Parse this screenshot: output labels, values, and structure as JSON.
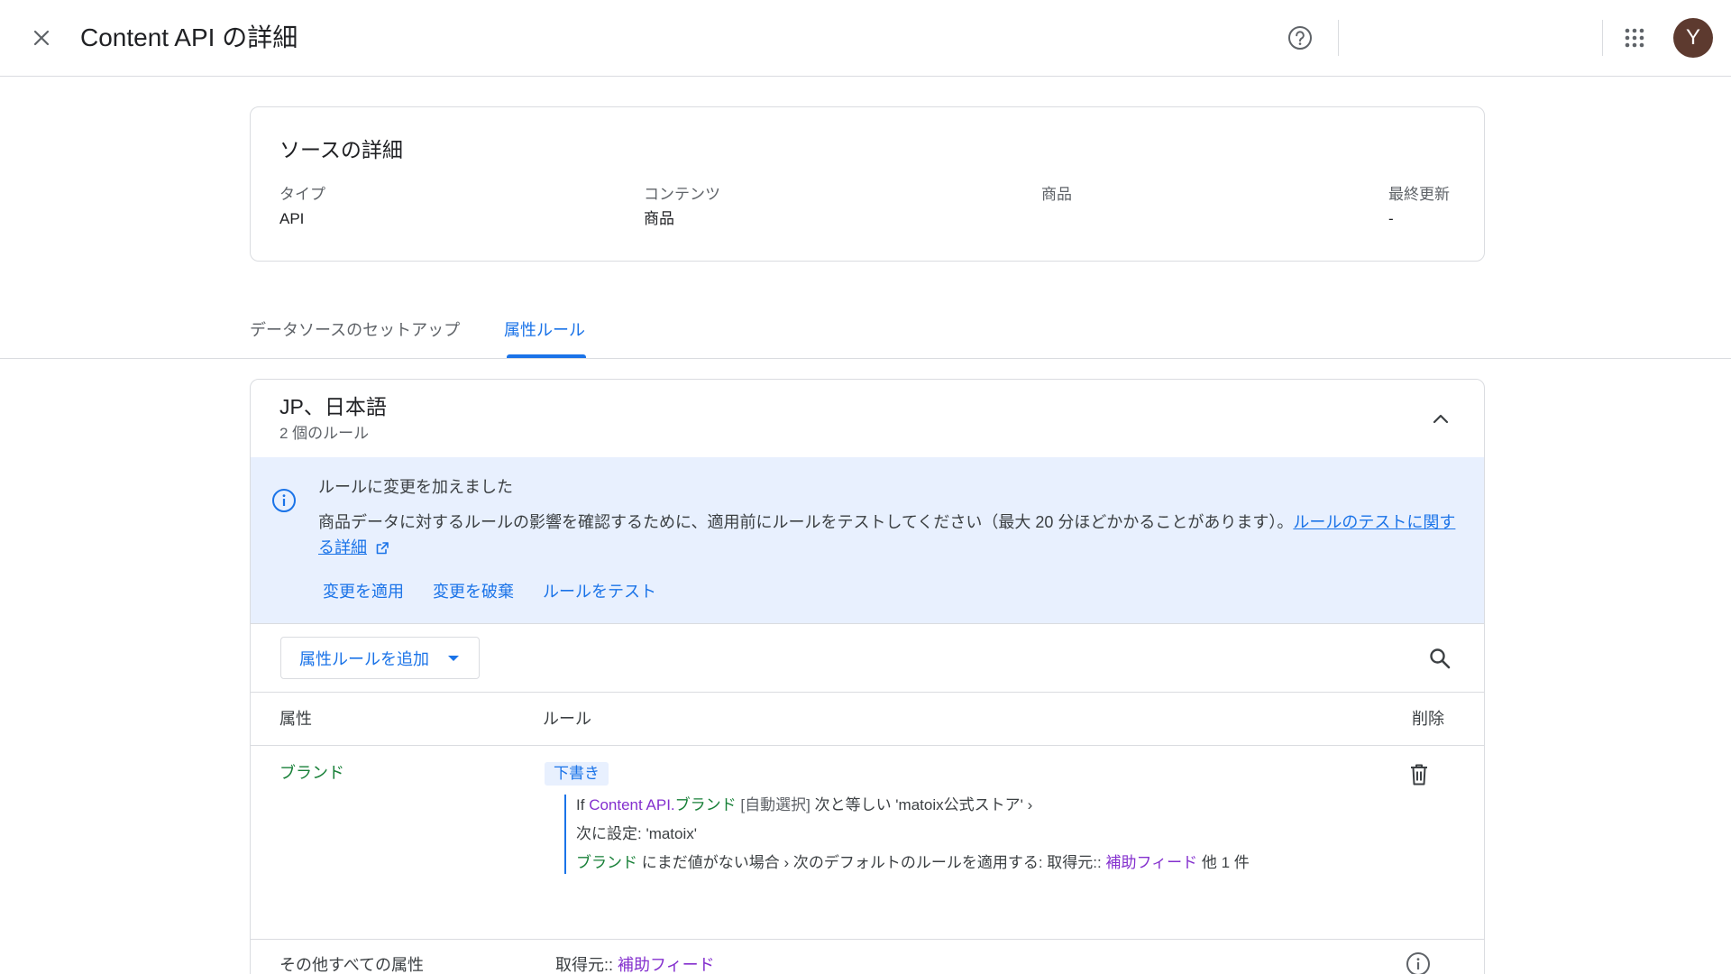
{
  "appbar": {
    "title": "Content API の詳細",
    "avatar_letter": "Y"
  },
  "source_details": {
    "heading": "ソースの詳細",
    "fields": [
      {
        "label": "タイプ",
        "value": "API"
      },
      {
        "label": "コンテンツ",
        "value": "商品"
      },
      {
        "label": "商品",
        "value": ""
      },
      {
        "label": "最終更新",
        "value": "-"
      }
    ]
  },
  "tabs": [
    {
      "label": "データソースのセットアップ",
      "active": false
    },
    {
      "label": "属性ルール",
      "active": true
    }
  ],
  "rules_section": {
    "title": "JP、日本語",
    "subtitle": "2 個のルール",
    "banner": {
      "title": "ルールに変更を加えました",
      "body": "商品データに対するルールの影響を確認するために、適用前にルールをテストしてください（最大 20 分ほどかかることがあります）。",
      "link_text": "ルールのテストに関する詳細",
      "actions": [
        "変更を適用",
        "変更を破棄",
        "ルールをテスト"
      ]
    },
    "add_button_label": "属性ルールを追加",
    "table": {
      "headers": {
        "attribute": "属性",
        "rule": "ルール",
        "delete": "削除"
      },
      "rows": [
        {
          "attribute": "ブランド",
          "status_chip": "下書き",
          "rule_line1": {
            "if": "If",
            "source": "Content API",
            "dot": ".",
            "field": "ブランド",
            "mode": "[自動選択]",
            "op": "次と等しい 'matoix公式ストア' ›"
          },
          "rule_line2": "次に設定: 'matoix'",
          "rule_line3": {
            "field": "ブランド",
            "text": "にまだ値がない場合 › 次のデフォルトのルールを適用する: 取得元::",
            "link": "補助フィード",
            "more": "他 1 件"
          }
        },
        {
          "attribute": "その他すべての属性",
          "source_prefix": "取得元::",
          "source_link": "補助フィード"
        }
      ]
    }
  }
}
